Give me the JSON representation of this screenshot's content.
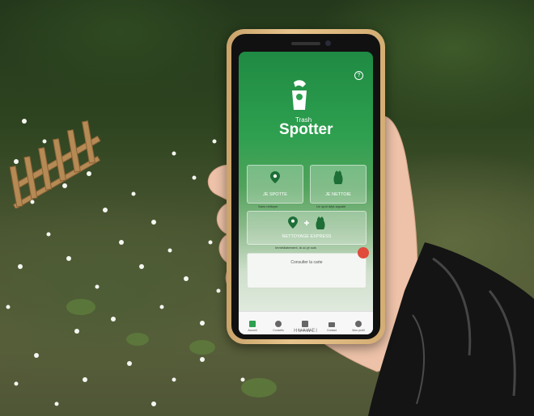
{
  "app": {
    "logo_small": "Trash",
    "logo_big": "Spotter",
    "btn_spot": "JE SPOTTE",
    "btn_clean": "JE NETTOIE",
    "btn_express": "NETTOYAGE EXPRESS",
    "map_label": "Consulter la carte",
    "sub_spot": "Sans nettoyer",
    "sub_clean": "Un spot déjà signalé",
    "sub_express": "Immédiatement, là où je suis",
    "nav": [
      "Accueil",
      "Conseils",
      "Partenaires",
      "Contact",
      "Mon profil"
    ]
  },
  "device_brand": "HUAWEI",
  "colors": {
    "app_green": "#2ea04f",
    "phone_gold": "#e0bd86"
  }
}
